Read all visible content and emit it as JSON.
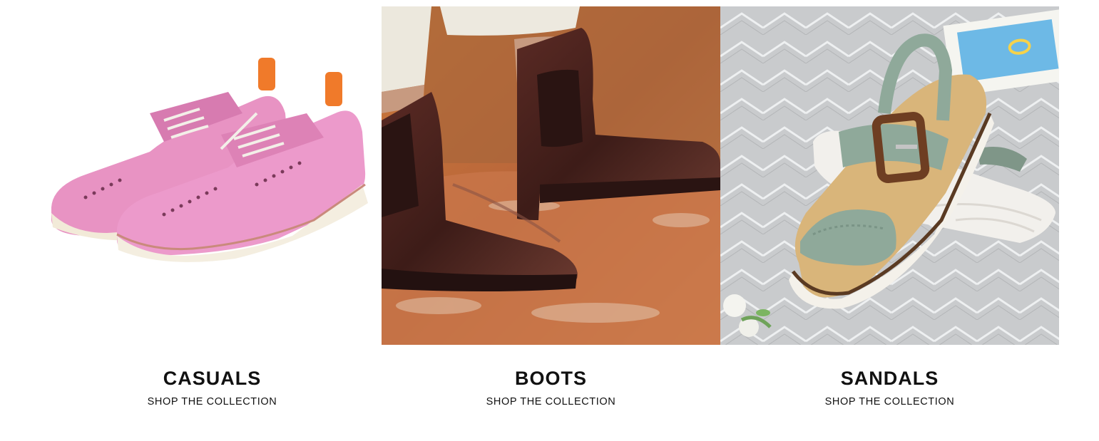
{
  "collections": [
    {
      "title": "CASUALS",
      "link_label": "SHOP THE COLLECTION",
      "image_subject": "pink-brogue-shoes"
    },
    {
      "title": "BOOTS",
      "link_label": "SHOP THE COLLECTION",
      "image_subject": "brown-chelsea-boots"
    },
    {
      "title": "SANDALS",
      "link_label": "SHOP THE COLLECTION",
      "image_subject": "sage-buckle-sandal"
    }
  ],
  "colors": {
    "text": "#111111",
    "background": "#ffffff",
    "casuals_leather": "#e88fbf",
    "boots_leather": "#4a2420",
    "sandal_strap": "#8fa99a"
  }
}
